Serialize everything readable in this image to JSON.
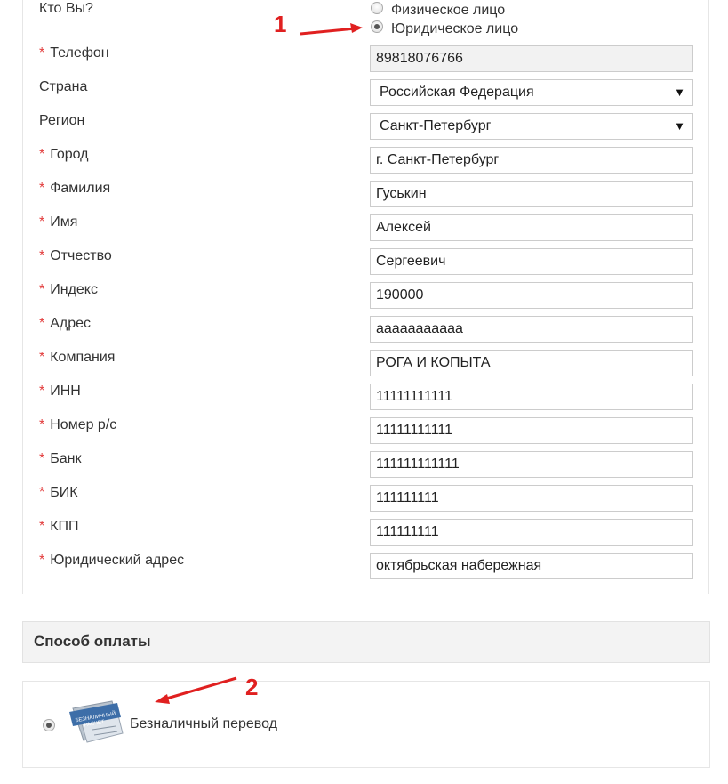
{
  "who": {
    "label": "Кто Вы?",
    "options": [
      {
        "label": "Физическое лицо",
        "checked": false
      },
      {
        "label": "Юридическое лицо",
        "checked": true
      }
    ]
  },
  "fields": [
    {
      "label": "Телефон",
      "required": true,
      "value": "89818076766",
      "type": "readonly"
    },
    {
      "label": "Страна",
      "required": false,
      "value": "Российская Федерация",
      "type": "select"
    },
    {
      "label": "Регион",
      "required": false,
      "value": "Санкт-Петербург",
      "type": "select"
    },
    {
      "label": "Город",
      "required": true,
      "value": "г. Санкт-Петербург",
      "type": "text"
    },
    {
      "label": "Фамилия",
      "required": true,
      "value": "Гуськин",
      "type": "text"
    },
    {
      "label": "Имя",
      "required": true,
      "value": "Алексей",
      "type": "text"
    },
    {
      "label": "Отчество",
      "required": true,
      "value": "Сергеевич",
      "type": "text"
    },
    {
      "label": "Индекс",
      "required": true,
      "value": "190000",
      "type": "text"
    },
    {
      "label": "Адрес",
      "required": true,
      "value": "ааааааааааа",
      "type": "text"
    },
    {
      "label": "Компания",
      "required": true,
      "value": "РОГА И КОПЫТА",
      "type": "text"
    },
    {
      "label": "ИНН",
      "required": true,
      "value": "11111111111",
      "type": "text"
    },
    {
      "label": "Номер р/с",
      "required": true,
      "value": "11111111111",
      "type": "text"
    },
    {
      "label": "Банк",
      "required": true,
      "value": "111111111111",
      "type": "text"
    },
    {
      "label": "БИК",
      "required": true,
      "value": "111111111",
      "type": "text"
    },
    {
      "label": "КПП",
      "required": true,
      "value": "111111111",
      "type": "text"
    },
    {
      "label": "Юридический адрес",
      "required": true,
      "value": "октябрьская набережная",
      "type": "text"
    }
  ],
  "required_mark": "*",
  "select_caret": "▼",
  "payment": {
    "title": "Способ оплаты",
    "option_label": "Безналичный перевод",
    "option_checked": true,
    "icon_stamp": "БЕЗНАЛИЧНЫЙ РАСЧЕТ"
  },
  "annotations": {
    "one": "1",
    "two": "2",
    "color": "#e02020"
  },
  "colors": {
    "required": "#e23b3b",
    "header_bg": "#f3f3f3"
  }
}
